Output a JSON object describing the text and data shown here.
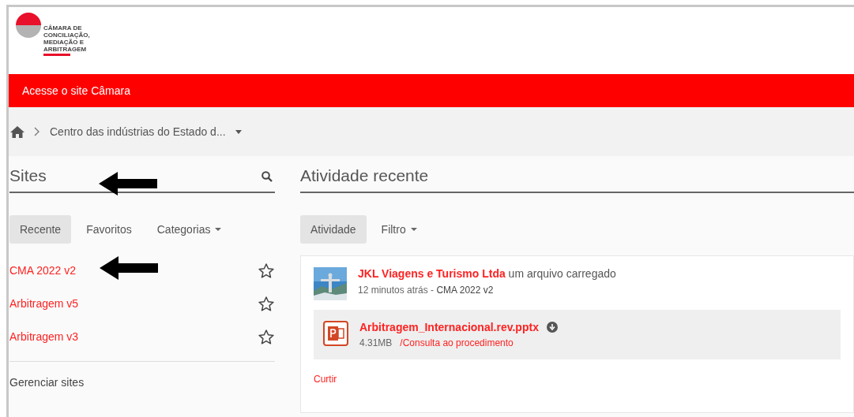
{
  "logo": {
    "lines": [
      "CÂMARA DE",
      "CONCILIAÇÃO,",
      "MEDIAÇÃO E",
      "ARBITRAGEM"
    ]
  },
  "banner": {
    "link": "Acesse o site Câmara"
  },
  "breadcrumb": {
    "current": "Centro das indústrias do Estado d..."
  },
  "sites": {
    "title": "Sites",
    "tabs": [
      {
        "label": "Recente",
        "selected": true,
        "dropdown": false
      },
      {
        "label": "Favoritos",
        "selected": false,
        "dropdown": false
      },
      {
        "label": "Categorias",
        "selected": false,
        "dropdown": true
      }
    ],
    "items": [
      {
        "name": "CMA 2022 v2",
        "favorite": false
      },
      {
        "name": "Arbitragem v5",
        "favorite": false
      },
      {
        "name": "Arbitragem v3",
        "favorite": false
      }
    ],
    "manage": "Gerenciar sites"
  },
  "activity": {
    "title": "Atividade recente",
    "tabs": [
      {
        "label": "Atividade",
        "selected": true,
        "dropdown": false
      },
      {
        "label": "Filtro",
        "selected": false,
        "dropdown": true
      }
    ],
    "entries": [
      {
        "user": "JKL Viagens e Turismo Ltda",
        "action": "um arquivo carregado",
        "time": "12 minutos atrás",
        "separator": " - ",
        "site": "CMA 2022 v2",
        "file": {
          "name": "Arbitragem_Internacional.rev.pptx",
          "size": "4.31MB",
          "path": "/Consulta ao procedimento"
        },
        "like": "Curtir"
      }
    ]
  }
}
